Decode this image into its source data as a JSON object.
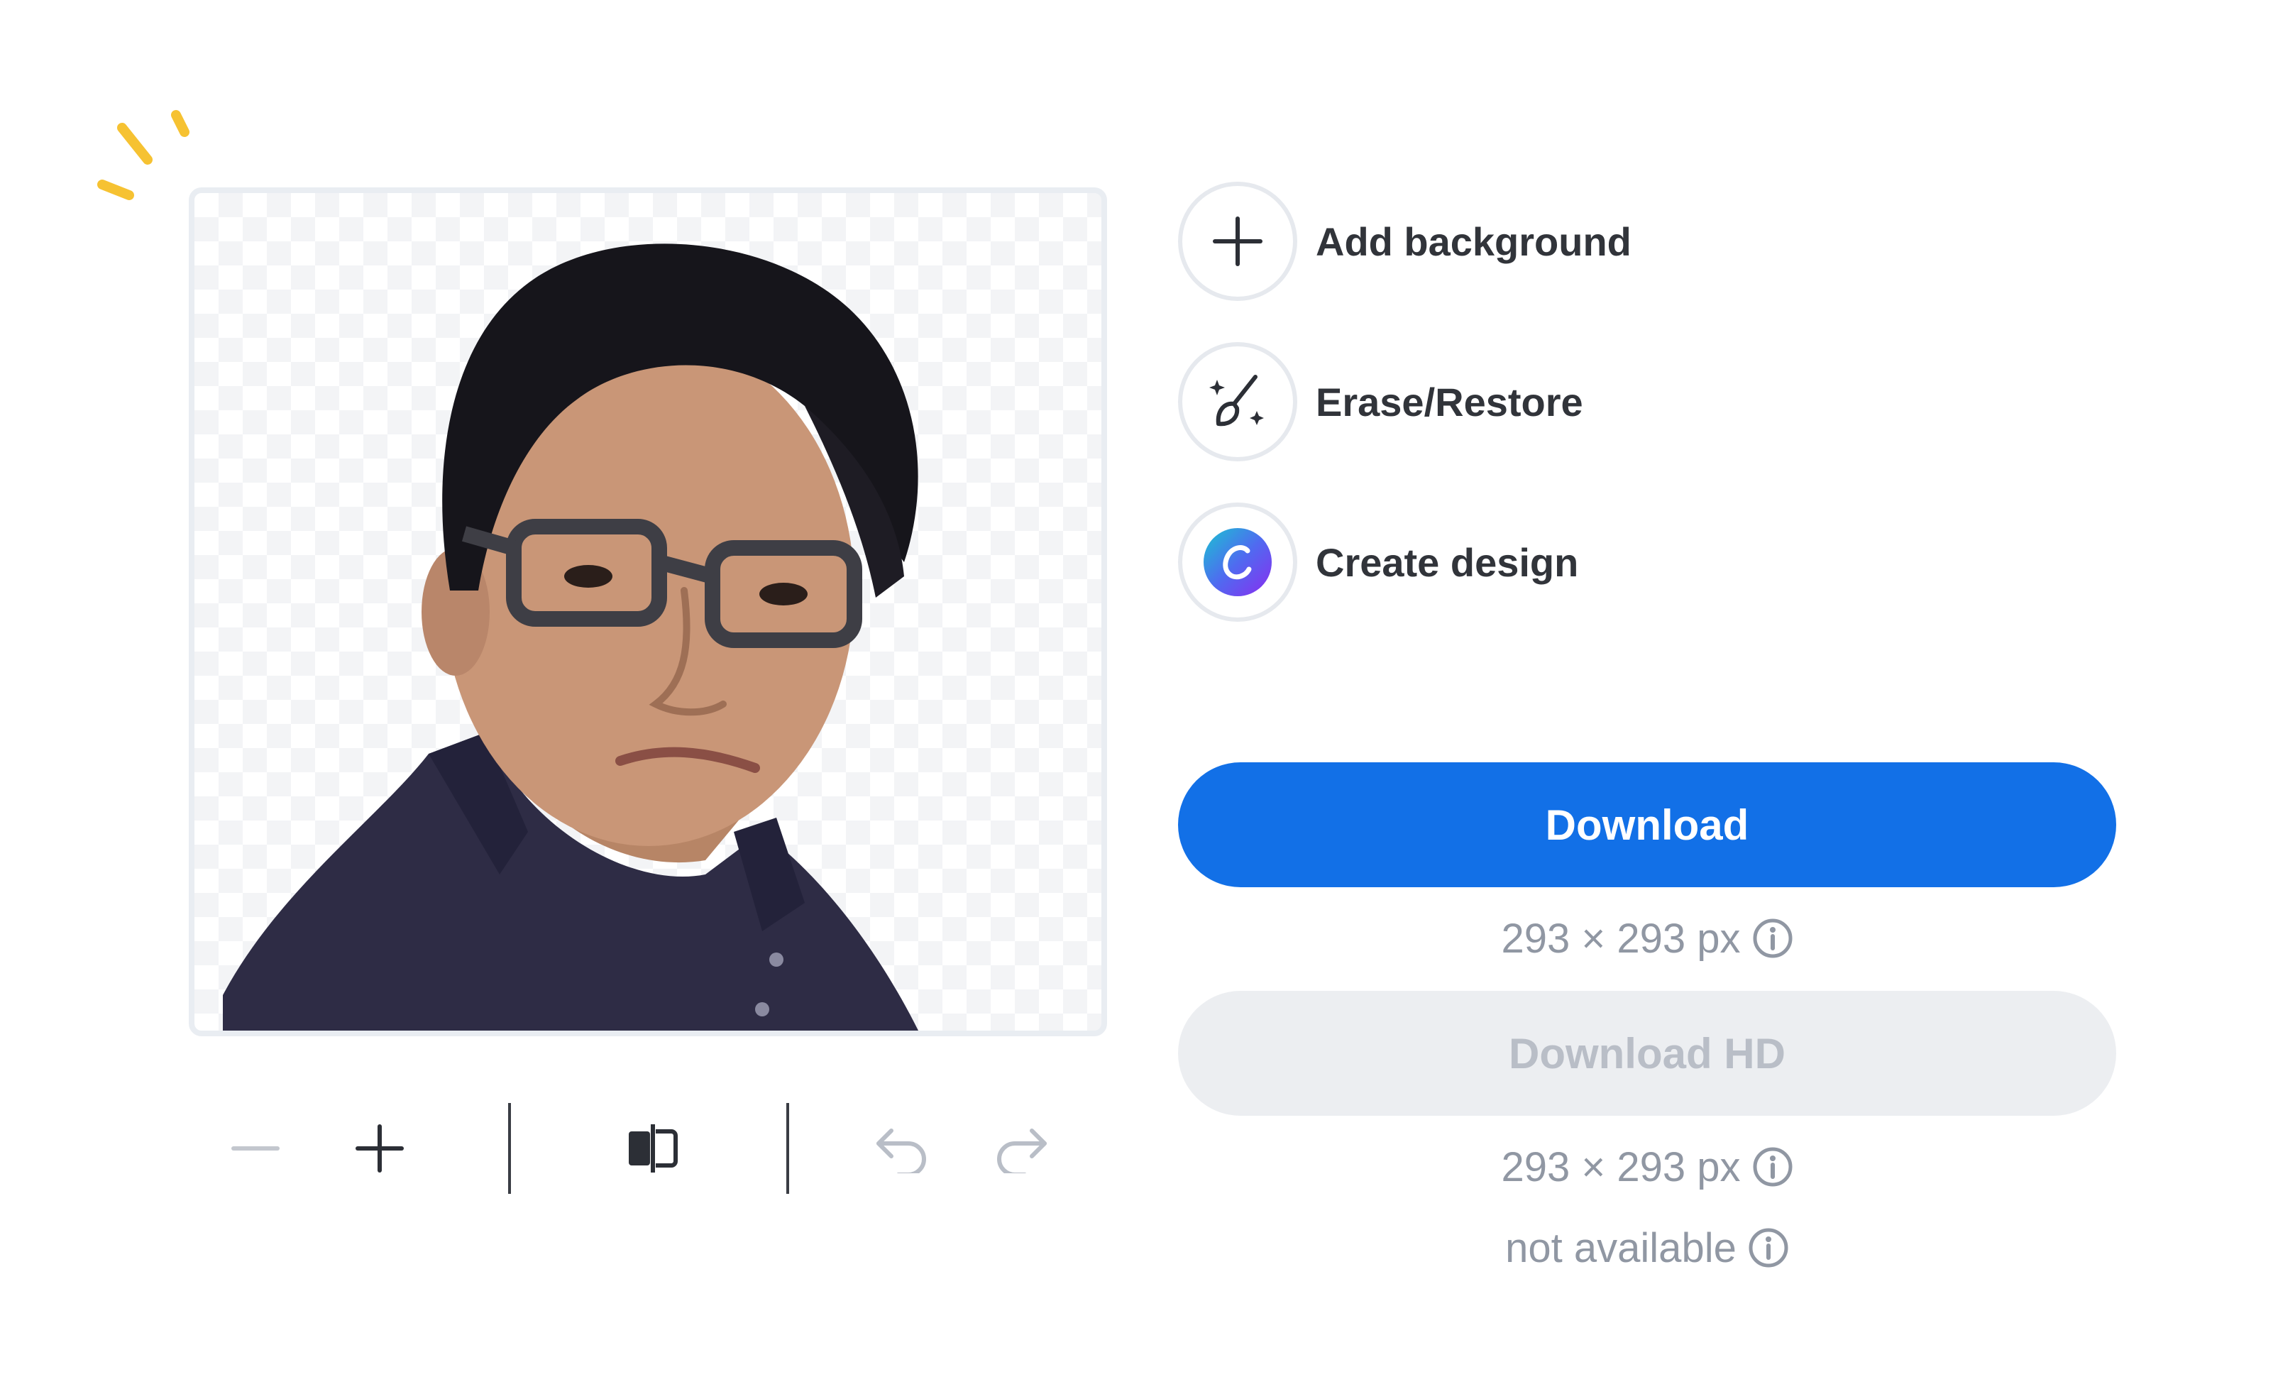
{
  "preview": {
    "image_description_icon": "person-cutout-image"
  },
  "toolbar": {
    "zoom_out_icon": "minus-icon",
    "zoom_in_icon": "plus-icon",
    "compare_icon": "compare-toggle-icon",
    "undo_icon": "undo-icon",
    "redo_icon": "redo-icon"
  },
  "actions": [
    {
      "label": "Add background",
      "icon": "plus-icon"
    },
    {
      "label": "Erase/Restore",
      "icon": "magic-brush-icon"
    },
    {
      "label": "Create design",
      "icon": "canva-logo-icon"
    }
  ],
  "download": {
    "label": "Download",
    "size": "293 × 293 px"
  },
  "download_hd": {
    "label": "Download HD",
    "size": "293 × 293 px",
    "availability": "not available"
  },
  "colors": {
    "primary": "#1270e7",
    "disabled_bg": "#eceef1",
    "disabled_text": "#b9bec7",
    "muted_text": "#9097a3",
    "sparkle": "#f6c232"
  }
}
